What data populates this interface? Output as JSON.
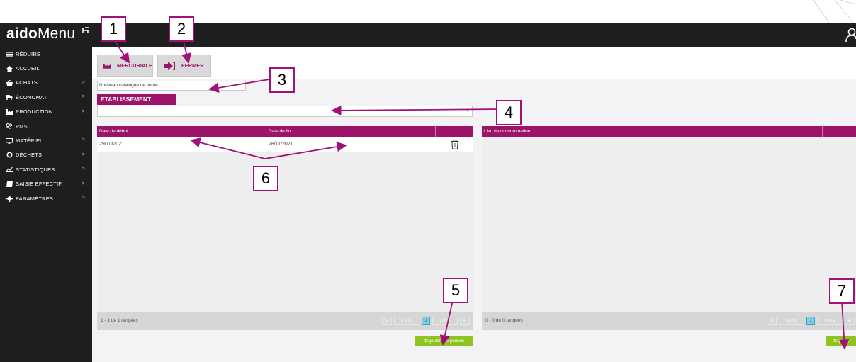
{
  "app": {
    "logo_bold": "aido",
    "logo_light": "Menu"
  },
  "sidebar": {
    "items": [
      {
        "label": "RÉDUIRE",
        "icon": "hamburger-icon",
        "chevron": false
      },
      {
        "label": "ACCUEIL",
        "icon": "home-icon",
        "chevron": false
      },
      {
        "label": "ACHATS",
        "icon": "basket-icon",
        "chevron": true
      },
      {
        "label": "ÉCONOMAT",
        "icon": "truck-icon",
        "chevron": true
      },
      {
        "label": "PRODUCTION",
        "icon": "factory-icon",
        "chevron": true
      },
      {
        "label": "PMS",
        "icon": "users-icon",
        "chevron": false
      },
      {
        "label": "MATÉRIEL",
        "icon": "monitor-icon",
        "chevron": true
      },
      {
        "label": "DÉCHETS",
        "icon": "recycle-icon",
        "chevron": true
      },
      {
        "label": "STATISTIQUES",
        "icon": "chart-icon",
        "chevron": true
      },
      {
        "label": "SAISIE EFFECTIF",
        "icon": "book-icon",
        "chevron": true
      },
      {
        "label": "PARAMÈTRES",
        "icon": "gear-icon",
        "chevron": true
      }
    ],
    "chevron_glyph": ">"
  },
  "toolbar": {
    "mercuriale_label": "MERCURIALE",
    "fermer_label": "FERMER"
  },
  "form": {
    "catalog_value": "Nouveau catalogue de vente",
    "etablissement_label": "ETABLISSEMENT",
    "dropdown_glyph": "▾"
  },
  "left_grid": {
    "columns": [
      "Date de début",
      "Date de fin"
    ],
    "rows": [
      {
        "start": "29/10/2021",
        "end": "28/11/2021"
      }
    ],
    "pager_info": "1 - 1 de 1 rangées",
    "pager": {
      "first": "|◂",
      "prev": "◂ préc",
      "page": "1",
      "next": "suiv ▸",
      "last": "▸|"
    },
    "add_button": "⊞Ajouter une période"
  },
  "right_grid": {
    "columns": [
      "Lieu de consommation"
    ],
    "pager_info": "0 - 0 de 0 rangées",
    "pager": {
      "first": "|◂",
      "prev": "◂ préc",
      "page": "1",
      "next": "suiv ▸",
      "last": "▸|"
    },
    "add_button": "⊞Ajouter"
  },
  "callouts": [
    "1",
    "2",
    "3",
    "4",
    "5",
    "6",
    "7"
  ],
  "colors": {
    "accent": "#9c1469",
    "callout_border": "#a0127a",
    "sidebar_bg": "#1e1e1e",
    "header_bg": "#1f1f1f",
    "green": "#8fc31f",
    "pager_active": "#7ecfe5"
  }
}
